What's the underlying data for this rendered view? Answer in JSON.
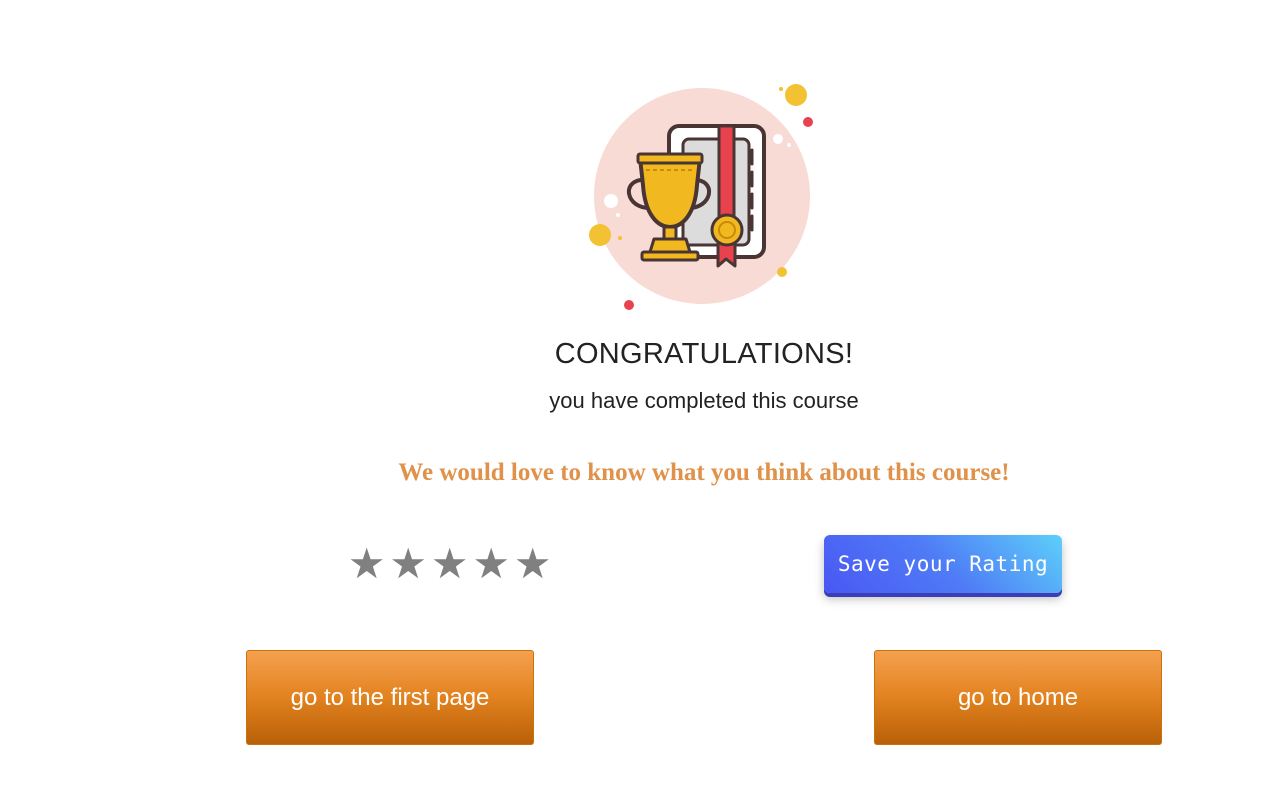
{
  "completion": {
    "title": "CONGRATULATIONS!",
    "subtitle": "you have completed this course"
  },
  "feedback": {
    "prompt": "We would love to know what you think about this course!",
    "rating": {
      "max": 5,
      "current": 0,
      "star_glyph": "★",
      "star_color": "#808080"
    },
    "save_label": "Save your Rating"
  },
  "navigation": {
    "first_page_label": "go to the first page",
    "home_label": "go to home"
  },
  "colors": {
    "accent_orange": "#e2821f",
    "prompt_orange": "#e0914a",
    "save_button_blue": "#4a57f4",
    "trophy_gold": "#f2b81f",
    "ribbon_red": "#e8424f",
    "circle_pink": "#f9dbd5"
  },
  "icons": {
    "illustration": "trophy-certificate-icon"
  }
}
